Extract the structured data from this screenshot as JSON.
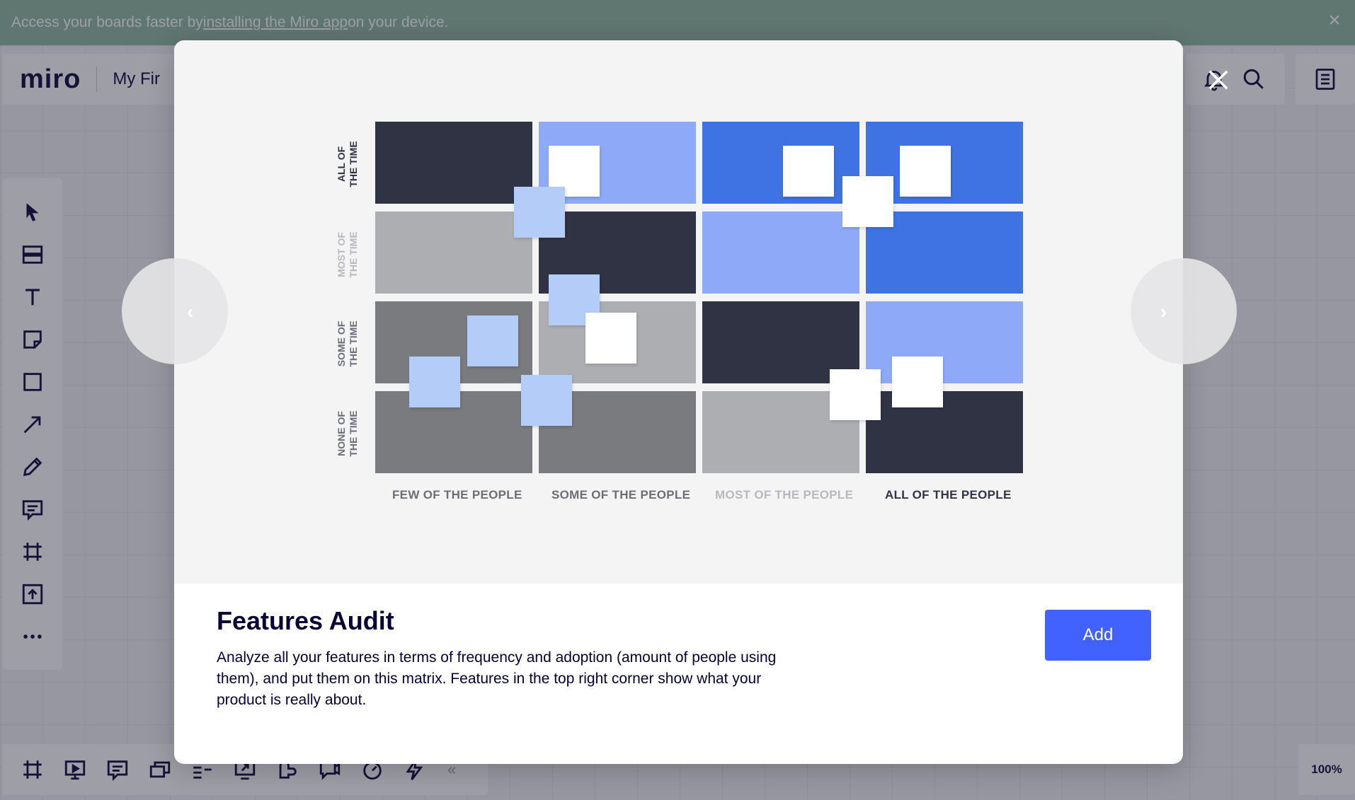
{
  "banner": {
    "text_before": "Access your boards faster by ",
    "link": "installing the Miro app",
    "text_after": " on your device."
  },
  "app": {
    "logo": "miro",
    "board_title": "My Fir"
  },
  "toolbar": {
    "icons": [
      "select-icon",
      "templates-icon",
      "text-icon",
      "sticky-note-icon",
      "shape-icon",
      "arrow-icon",
      "pen-icon",
      "comment-icon",
      "frame-icon",
      "upload-icon",
      "more-icon"
    ]
  },
  "bottombar": {
    "icons": [
      "frames-icon",
      "presentation-icon",
      "comments-icon",
      "cards-icon",
      "kanban-icon",
      "screen-share-icon",
      "reactions-icon",
      "video-icon",
      "timer-icon",
      "lightning-icon"
    ],
    "collapse": "«"
  },
  "zoom": "100%",
  "template": {
    "title": "Features Audit",
    "description": "Analyze all your features in terms of frequency and adoption (amount of people using them), and put them on this matrix. Features in the top right corner show what your product is really about.",
    "add_label": "Add"
  },
  "matrix": {
    "row_labels": [
      {
        "line1": "ALL OF",
        "line2": "THE TIME",
        "color": "#2f3344"
      },
      {
        "line1": "MOST OF",
        "line2": "THE TIME",
        "color": "#b7b9c0"
      },
      {
        "line1": "SOME OF",
        "line2": "THE TIME",
        "color": "#6b6e78"
      },
      {
        "line1": "NONE OF",
        "line2": "THE TIME",
        "color": "#6b6e78"
      }
    ],
    "col_labels": [
      {
        "text": "FEW OF THE PEOPLE",
        "color": "#6b6e78"
      },
      {
        "text": "SOME OF THE PEOPLE",
        "color": "#6b6e78"
      },
      {
        "text": "MOST OF THE PEOPLE",
        "color": "#b7b9c0"
      },
      {
        "text": "ALL OF THE PEOPLE",
        "color": "#2f3344"
      }
    ],
    "cell_colors": [
      [
        "#2f3344",
        "#8ea9f8",
        "#3f73e4",
        "#3f73e4"
      ],
      [
        "#adaeb2",
        "#2f3344",
        "#8ea9f8",
        "#3f73e4"
      ],
      [
        "#7a7b7e",
        "#adaeb2",
        "#2f3344",
        "#8ea9f8"
      ],
      [
        "#7a7b7e",
        "#7a7b7e",
        "#adaeb2",
        "#2f3344"
      ]
    ]
  },
  "colors": {
    "accent": "#4262ff",
    "text_dark": "#050038",
    "banner": "#8fb79c"
  }
}
